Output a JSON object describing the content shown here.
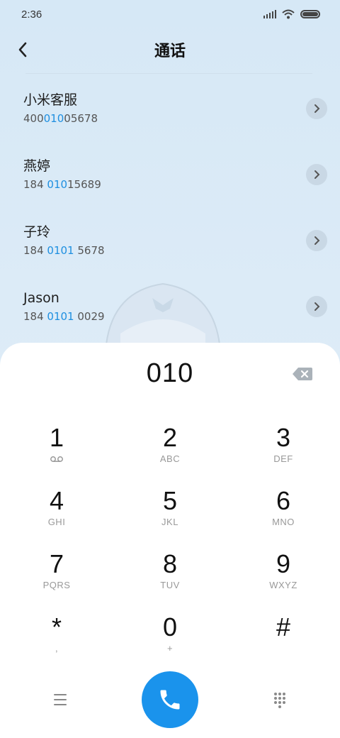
{
  "status": {
    "time": "2:36"
  },
  "header": {
    "title": "通话"
  },
  "contacts": [
    {
      "name": "小米客服",
      "number_pre": "400",
      "number_match": "010",
      "number_post": "05678"
    },
    {
      "name": "燕婷",
      "number_pre": "184 ",
      "number_match": "010",
      "number_post": "15689"
    },
    {
      "name": "子玲",
      "number_pre": "184 ",
      "number_match": "0101",
      "number_post": " 5678"
    },
    {
      "name": "Jason",
      "number_pre": "184 ",
      "number_match": "0101",
      "number_post": " 0029"
    }
  ],
  "dialer": {
    "digits": "010",
    "keys": [
      {
        "digit": "1",
        "letters": ""
      },
      {
        "digit": "2",
        "letters": "ABC"
      },
      {
        "digit": "3",
        "letters": "DEF"
      },
      {
        "digit": "4",
        "letters": "GHI"
      },
      {
        "digit": "5",
        "letters": "JKL"
      },
      {
        "digit": "6",
        "letters": "MNO"
      },
      {
        "digit": "7",
        "letters": "PQRS"
      },
      {
        "digit": "8",
        "letters": "TUV"
      },
      {
        "digit": "9",
        "letters": "WXYZ"
      },
      {
        "digit": "*",
        "letters": ","
      },
      {
        "digit": "0",
        "letters": "+"
      },
      {
        "digit": "#",
        "letters": ""
      }
    ]
  },
  "colors": {
    "accent": "#1a93ec",
    "highlight": "#1e8fe0"
  },
  "icons": {
    "back": "back-arrow-icon",
    "detail": "chevron-right-icon",
    "backspace": "backspace-icon",
    "voicemail": "voicemail-icon",
    "menu": "menu-icon",
    "call": "phone-icon",
    "dialpad": "dialpad-icon"
  }
}
